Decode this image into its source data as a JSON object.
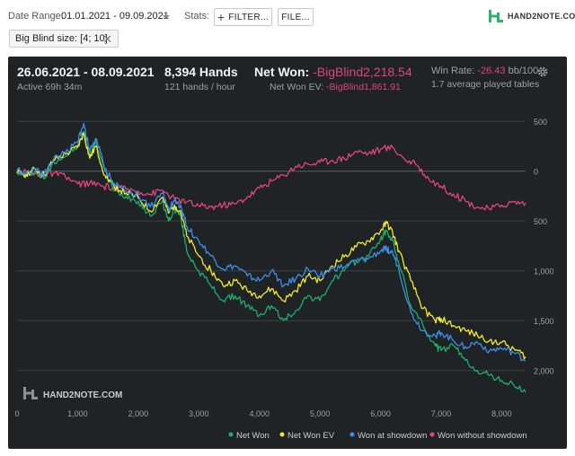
{
  "toolbar": {
    "date_range_label": "Date Range:",
    "date_range_value": "01.01.2021 - 09.09.2021",
    "stats_label": "Stats:",
    "filter_button": "FILTER...",
    "file_button": "FILE...",
    "logo_text": "HAND2NOTE.COM",
    "chip_label": "Big Blind size: [4; 10]"
  },
  "summary": {
    "period": "26.06.2021 - 08.09.2021",
    "active": "Active 69h 34m",
    "hands": "8,394 Hands",
    "hands_rate": "121 hands / hour",
    "net_won_label": "Net Won:",
    "net_won_value": "-BigBlind2,218.54",
    "net_won_ev_label": "Net Won  EV:",
    "net_won_ev_value": "-BigBlind1,861.91",
    "win_rate_label": "Win Rate:",
    "win_rate_value": "-26.43",
    "win_rate_unit": "bb/100",
    "tables": "1.7 average played tables"
  },
  "watermark": "HAND2NOTE.COM",
  "colors": {
    "net_won": "#1fae6a",
    "net_won_ev": "#f2ea2c",
    "won_at_showdown": "#3d8ee6",
    "won_without_showdown": "#e0457b",
    "panel_bg": "#1f2326"
  },
  "chart_data": {
    "type": "line",
    "x_ticks": [
      "0",
      "1,000",
      "2,000",
      "3,000",
      "4,000",
      "5,000",
      "6,000",
      "7,000",
      "8,000"
    ],
    "y_ticks": [
      "500",
      "0",
      "500",
      "1,000",
      "1,500",
      "2,000"
    ],
    "xlim": [
      0,
      8394
    ],
    "ylim": [
      -2300,
      700
    ],
    "y_inverted": true,
    "series": [
      {
        "name": "Net Won",
        "color": "#1fae6a",
        "points": [
          [
            0,
            0
          ],
          [
            150,
            -50
          ],
          [
            300,
            0
          ],
          [
            450,
            -80
          ],
          [
            600,
            100
          ],
          [
            800,
            150
          ],
          [
            1000,
            250
          ],
          [
            1100,
            400
          ],
          [
            1200,
            150
          ],
          [
            1300,
            300
          ],
          [
            1450,
            0
          ],
          [
            1600,
            -200
          ],
          [
            1800,
            -250
          ],
          [
            2000,
            -300
          ],
          [
            2200,
            -450
          ],
          [
            2400,
            -300
          ],
          [
            2500,
            -500
          ],
          [
            2600,
            -380
          ],
          [
            2700,
            -450
          ],
          [
            2800,
            -800
          ],
          [
            3000,
            -1000
          ],
          [
            3200,
            -1150
          ],
          [
            3400,
            -1300
          ],
          [
            3600,
            -1250
          ],
          [
            3800,
            -1350
          ],
          [
            4000,
            -1450
          ],
          [
            4200,
            -1350
          ],
          [
            4400,
            -1500
          ],
          [
            4600,
            -1400
          ],
          [
            4800,
            -1250
          ],
          [
            5000,
            -1300
          ],
          [
            5200,
            -1100
          ],
          [
            5400,
            -1000
          ],
          [
            5600,
            -900
          ],
          [
            5800,
            -850
          ],
          [
            6000,
            -680
          ],
          [
            6100,
            -600
          ],
          [
            6200,
            -700
          ],
          [
            6300,
            -920
          ],
          [
            6500,
            -1350
          ],
          [
            6700,
            -1550
          ],
          [
            6900,
            -1750
          ],
          [
            7000,
            -1800
          ],
          [
            7200,
            -1750
          ],
          [
            7400,
            -1900
          ],
          [
            7600,
            -2000
          ],
          [
            7800,
            -2050
          ],
          [
            8000,
            -2100
          ],
          [
            8200,
            -2150
          ],
          [
            8394,
            -2218
          ]
        ]
      },
      {
        "name": "Net Won  EV",
        "color": "#f2ea2c",
        "points": [
          [
            0,
            -20
          ],
          [
            150,
            -30
          ],
          [
            300,
            20
          ],
          [
            450,
            -40
          ],
          [
            600,
            110
          ],
          [
            800,
            170
          ],
          [
            1000,
            240
          ],
          [
            1100,
            380
          ],
          [
            1200,
            130
          ],
          [
            1300,
            250
          ],
          [
            1450,
            -40
          ],
          [
            1600,
            -150
          ],
          [
            1800,
            -220
          ],
          [
            2000,
            -270
          ],
          [
            2200,
            -400
          ],
          [
            2400,
            -260
          ],
          [
            2500,
            -420
          ],
          [
            2600,
            -340
          ],
          [
            2700,
            -400
          ],
          [
            2800,
            -650
          ],
          [
            3000,
            -850
          ],
          [
            3200,
            -1000
          ],
          [
            3400,
            -1150
          ],
          [
            3600,
            -1100
          ],
          [
            3800,
            -1200
          ],
          [
            4000,
            -1250
          ],
          [
            4200,
            -1180
          ],
          [
            4400,
            -1300
          ],
          [
            4600,
            -1200
          ],
          [
            4800,
            -1050
          ],
          [
            5000,
            -1100
          ],
          [
            5200,
            -950
          ],
          [
            5400,
            -860
          ],
          [
            5600,
            -760
          ],
          [
            5800,
            -700
          ],
          [
            6000,
            -600
          ],
          [
            6100,
            -520
          ],
          [
            6200,
            -620
          ],
          [
            6300,
            -800
          ],
          [
            6500,
            -1100
          ],
          [
            6700,
            -1380
          ],
          [
            6900,
            -1500
          ],
          [
            7000,
            -1480
          ],
          [
            7200,
            -1550
          ],
          [
            7400,
            -1600
          ],
          [
            7600,
            -1650
          ],
          [
            7800,
            -1700
          ],
          [
            8000,
            -1720
          ],
          [
            8200,
            -1780
          ],
          [
            8394,
            -1862
          ]
        ]
      },
      {
        "name": "Won at showdown",
        "color": "#3d8ee6",
        "points": [
          [
            0,
            10
          ],
          [
            150,
            -20
          ],
          [
            300,
            30
          ],
          [
            450,
            -30
          ],
          [
            600,
            120
          ],
          [
            800,
            190
          ],
          [
            1000,
            300
          ],
          [
            1100,
            480
          ],
          [
            1200,
            200
          ],
          [
            1300,
            330
          ],
          [
            1450,
            30
          ],
          [
            1600,
            -120
          ],
          [
            1800,
            -200
          ],
          [
            2000,
            -240
          ],
          [
            2200,
            -360
          ],
          [
            2400,
            -220
          ],
          [
            2500,
            -380
          ],
          [
            2600,
            -300
          ],
          [
            2700,
            -340
          ],
          [
            2800,
            -550
          ],
          [
            3000,
            -700
          ],
          [
            3200,
            -850
          ],
          [
            3400,
            -980
          ],
          [
            3600,
            -950
          ],
          [
            3800,
            -1050
          ],
          [
            4000,
            -1100
          ],
          [
            4200,
            -1000
          ],
          [
            4400,
            -1150
          ],
          [
            4600,
            -1080
          ],
          [
            4800,
            -980
          ],
          [
            5000,
            -1050
          ],
          [
            5200,
            -980
          ],
          [
            5400,
            -960
          ],
          [
            5600,
            -900
          ],
          [
            5800,
            -880
          ],
          [
            6000,
            -800
          ],
          [
            6100,
            -780
          ],
          [
            6200,
            -820
          ],
          [
            6300,
            -980
          ],
          [
            6500,
            -1420
          ],
          [
            6700,
            -1600
          ],
          [
            6900,
            -1650
          ],
          [
            7000,
            -1620
          ],
          [
            7200,
            -1700
          ],
          [
            7400,
            -1760
          ],
          [
            7600,
            -1720
          ],
          [
            7800,
            -1800
          ],
          [
            8000,
            -1780
          ],
          [
            8200,
            -1820
          ],
          [
            8394,
            -1900
          ]
        ]
      },
      {
        "name": "Won without showdown",
        "color": "#e0457b",
        "points": [
          [
            0,
            0
          ],
          [
            200,
            -20
          ],
          [
            400,
            -40
          ],
          [
            600,
            -20
          ],
          [
            800,
            -60
          ],
          [
            1000,
            -130
          ],
          [
            1200,
            -120
          ],
          [
            1400,
            -150
          ],
          [
            1600,
            -170
          ],
          [
            1800,
            -180
          ],
          [
            2000,
            -200
          ],
          [
            2200,
            -230
          ],
          [
            2400,
            -190
          ],
          [
            2600,
            -280
          ],
          [
            2800,
            -310
          ],
          [
            3000,
            -350
          ],
          [
            3200,
            -360
          ],
          [
            3400,
            -340
          ],
          [
            3600,
            -330
          ],
          [
            3800,
            -260
          ],
          [
            4000,
            -170
          ],
          [
            4200,
            -100
          ],
          [
            4400,
            -40
          ],
          [
            4600,
            50
          ],
          [
            4800,
            70
          ],
          [
            5000,
            90
          ],
          [
            5200,
            110
          ],
          [
            5400,
            130
          ],
          [
            5600,
            200
          ],
          [
            5800,
            180
          ],
          [
            6000,
            220
          ],
          [
            6200,
            240
          ],
          [
            6400,
            120
          ],
          [
            6600,
            60
          ],
          [
            6800,
            -80
          ],
          [
            7000,
            -150
          ],
          [
            7200,
            -230
          ],
          [
            7400,
            -300
          ],
          [
            7600,
            -360
          ],
          [
            7800,
            -380
          ],
          [
            8000,
            -340
          ],
          [
            8200,
            -310
          ],
          [
            8394,
            -320
          ]
        ]
      }
    ],
    "legend": [
      "Net Won",
      "Net Won  EV",
      "Won at showdown",
      "Won without showdown"
    ],
    "legend_position": "bottom-right",
    "grid": true
  }
}
